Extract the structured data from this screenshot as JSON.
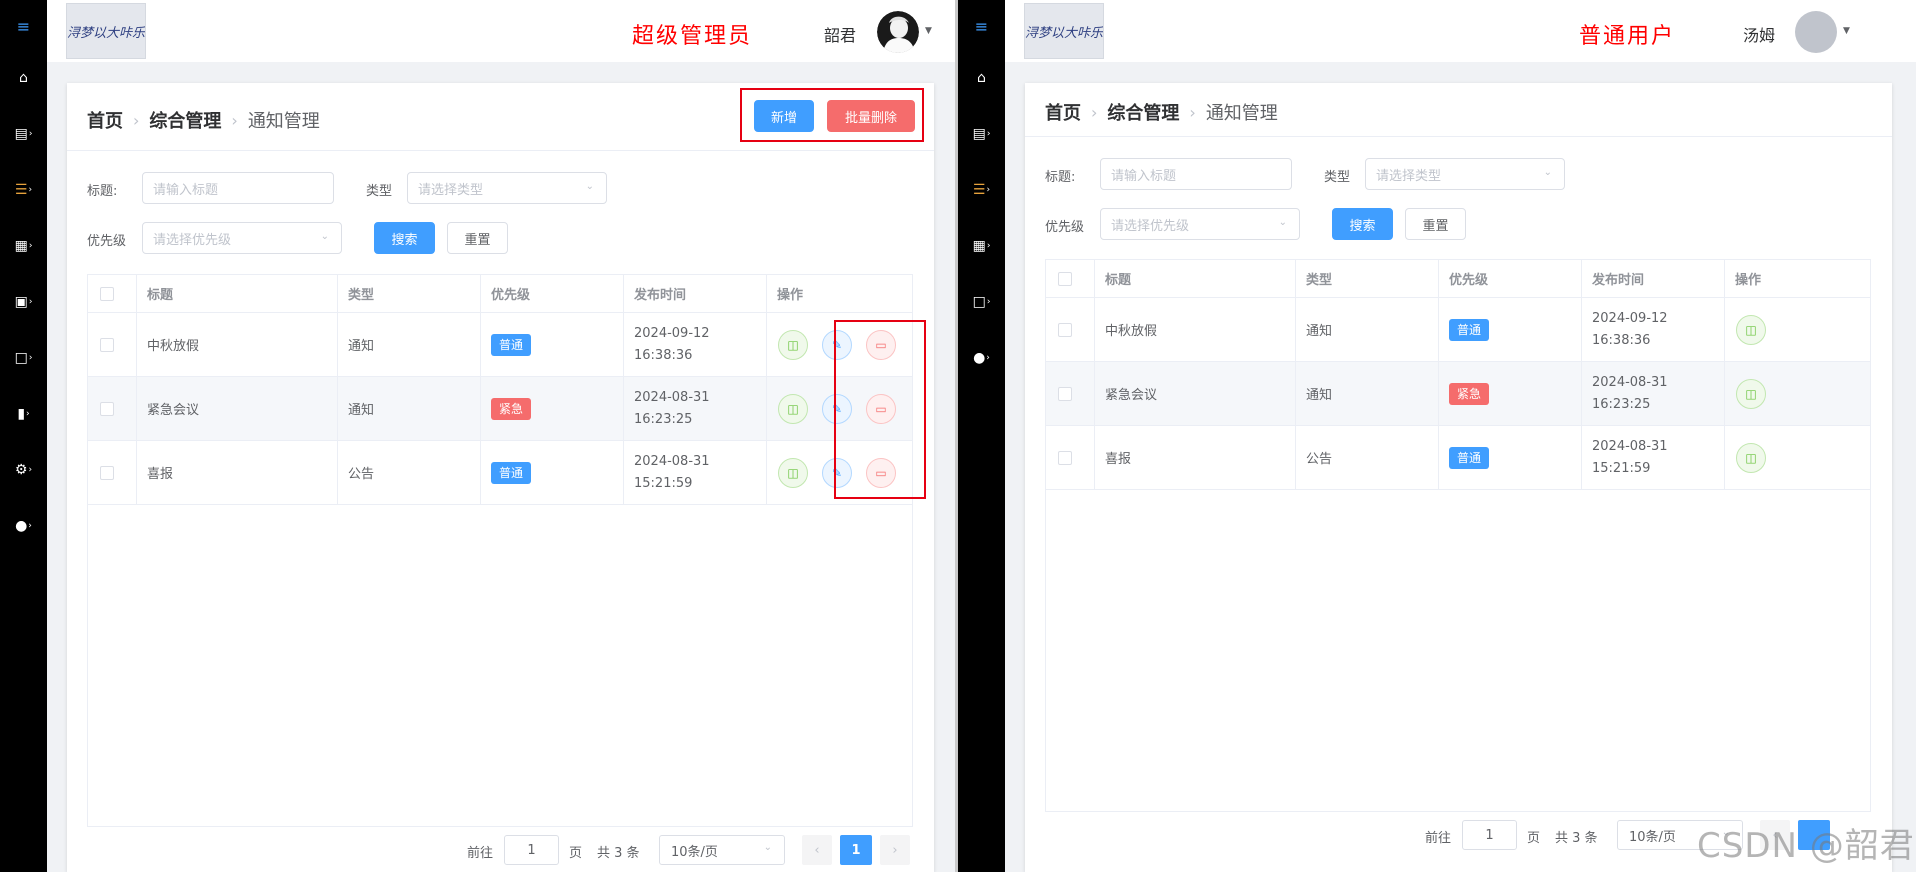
{
  "admin": {
    "role_label": "超级管理员",
    "username": "韶君",
    "logo_text": "浔梦以大咔乐",
    "breadcrumb": [
      "首页",
      "综合管理",
      "通知管理"
    ],
    "add_button": "新增",
    "batch_delete_button": "批量删除",
    "filters": {
      "title_label": "标题:",
      "title_placeholder": "请输入标题",
      "type_label": "类型",
      "type_placeholder": "请选择类型",
      "priority_label": "优先级",
      "priority_placeholder": "请选择优先级",
      "search_button": "搜索",
      "reset_button": "重置"
    },
    "table": {
      "headers": [
        "标题",
        "类型",
        "优先级",
        "发布时间",
        "操作"
      ],
      "rows": [
        {
          "title": "中秋放假",
          "type": "通知",
          "priority": "普通",
          "date": "2024-09-12",
          "time": "16:38:36"
        },
        {
          "title": "紧急会议",
          "type": "通知",
          "priority": "紧急",
          "date": "2024-08-31",
          "time": "16:23:25"
        },
        {
          "title": "喜报",
          "type": "公告",
          "priority": "普通",
          "date": "2024-08-31",
          "time": "15:21:59"
        }
      ]
    },
    "pagination": {
      "goto_label": "前往",
      "page_value": "1",
      "page_unit": "页",
      "total_text": "共 3 条",
      "page_size": "10条/页",
      "current_page": "1"
    }
  },
  "user": {
    "role_label": "普通用户",
    "username": "汤姆",
    "logo_text": "浔梦以大咔乐",
    "breadcrumb": [
      "首页",
      "综合管理",
      "通知管理"
    ],
    "filters": {
      "title_label": "标题:",
      "title_placeholder": "请输入标题",
      "type_label": "类型",
      "type_placeholder": "请选择类型",
      "priority_label": "优先级",
      "priority_placeholder": "请选择优先级",
      "search_button": "搜索",
      "reset_button": "重置"
    },
    "table": {
      "headers": [
        "标题",
        "类型",
        "优先级",
        "发布时间",
        "操作"
      ],
      "rows": [
        {
          "title": "中秋放假",
          "type": "通知",
          "priority": "普通",
          "date": "2024-09-12",
          "time": "16:38:36"
        },
        {
          "title": "紧急会议",
          "type": "通知",
          "priority": "紧急",
          "date": "2024-08-31",
          "time": "16:23:25"
        },
        {
          "title": "喜报",
          "type": "公告",
          "priority": "普通",
          "date": "2024-08-31",
          "time": "15:21:59"
        }
      ]
    },
    "pagination": {
      "goto_label": "前往",
      "page_value": "1",
      "page_unit": "页",
      "total_text": "共 3 条",
      "page_size": "10条/页"
    }
  },
  "icons": {
    "admin_sidebar": [
      "menu-toggle-icon",
      "home-icon",
      "calendar-icon",
      "sliders-icon",
      "grid-icon",
      "bag-icon",
      "folder-icon",
      "books-icon",
      "gear-icon",
      "user-icon"
    ],
    "user_sidebar": [
      "menu-toggle-icon",
      "home-icon",
      "calendar-icon",
      "sliders-icon",
      "grid-icon",
      "folder-icon",
      "user-icon"
    ]
  },
  "colors": {
    "primary": "#409eff",
    "danger": "#f56c6c",
    "success": "#67c23a",
    "role_text": "#ff0000",
    "highlight_box": "#e60012",
    "sidebar": "#000000"
  },
  "watermark": "CSDN @韶君"
}
